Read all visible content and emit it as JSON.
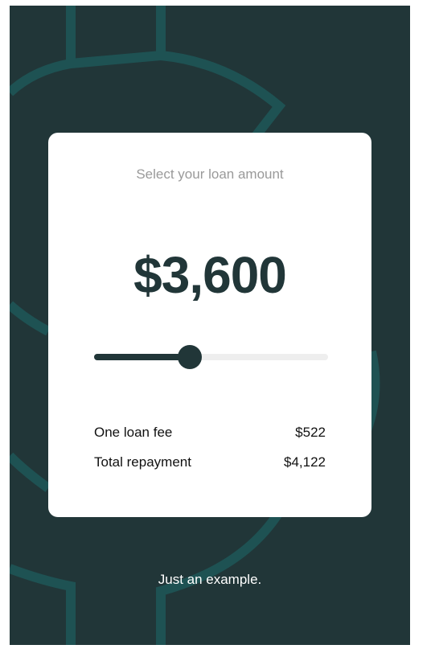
{
  "loan": {
    "prompt": "Select your loan amount",
    "amount": "$3,600",
    "slider_fraction": 0.41
  },
  "summary": {
    "fee_label": "One loan fee",
    "fee_value": "$522",
    "total_label": "Total repayment",
    "total_value": "$4,122"
  },
  "footer": {
    "note": "Just an example."
  },
  "colors": {
    "background": "#213638",
    "accent": "#213638",
    "symbol_stroke": "#1E5253",
    "card": "#FFFFFF",
    "track": "#EEEEEE"
  }
}
